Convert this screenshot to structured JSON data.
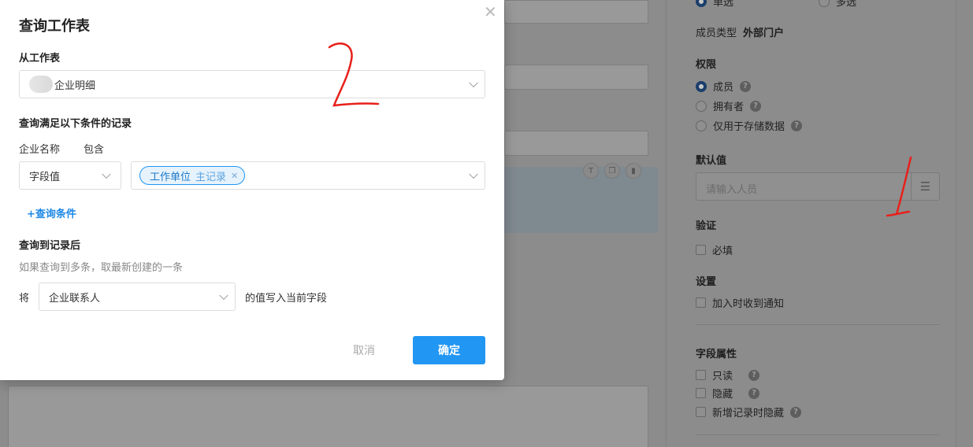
{
  "modal": {
    "title": "查询工作表",
    "source_label": "从工作表",
    "source_value": "企业明细",
    "conditions_label": "查询满足以下条件的记录",
    "condition": {
      "field": "企业名称",
      "operator": "包含",
      "value_type": "字段值",
      "tag_main": "工作单位",
      "tag_sub": "主记录"
    },
    "add_condition": "+查询条件",
    "after_label": "查询到记录后",
    "after_hint": "如果查询到多条，取最新创建的一条",
    "write_prefix": "将",
    "write_field": "企业联系人",
    "write_suffix": "的值写入当前字段",
    "cancel": "取消",
    "confirm": "确定"
  },
  "panel": {
    "option_single": "单选",
    "option_multi": "多选",
    "member_type_label": "成员类型",
    "member_type_value": "外部门户",
    "permission_title": "权限",
    "permission_options": [
      "成员",
      "拥有者",
      "仅用于存储数据"
    ],
    "default_title": "默认值",
    "default_placeholder": "请输入人员",
    "validate_title": "验证",
    "required": "必填",
    "settings_title": "设置",
    "notify": "加入时收到通知",
    "field_attr_title": "字段属性",
    "readonly": "只读",
    "hidden": "隐藏",
    "hide_on_new": "新增记录时隐藏",
    "help_glyph": "?"
  },
  "annotations": {
    "one": "1",
    "two": "2"
  },
  "colors": {
    "accent": "#2196f3",
    "annotation": "#e8201a"
  }
}
